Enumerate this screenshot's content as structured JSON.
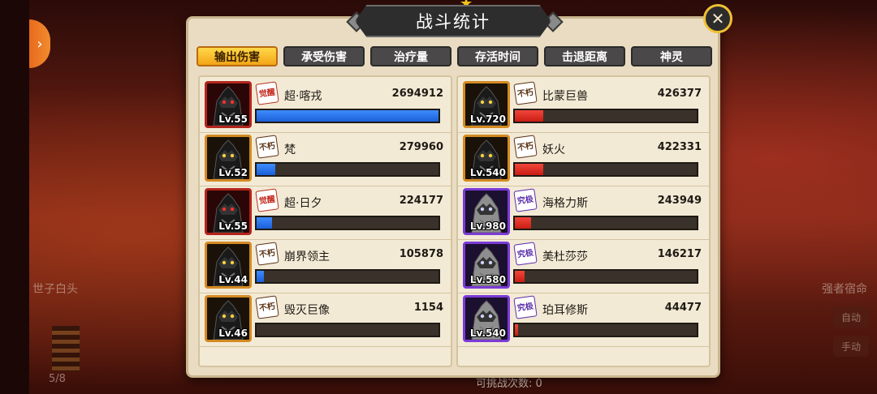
{
  "panel": {
    "title": "战斗统计",
    "tabs": [
      {
        "label": "输出伤害",
        "active": true
      },
      {
        "label": "承受伤害",
        "active": false
      },
      {
        "label": "治疗量",
        "active": false
      },
      {
        "label": "存活时间",
        "active": false
      },
      {
        "label": "击退距离",
        "active": false
      },
      {
        "label": "神灵",
        "active": false
      }
    ]
  },
  "left_team": [
    {
      "name": "超·喀戎",
      "value": "2694912",
      "level": "Lv.55",
      "rank": "觉醒",
      "frame": "red",
      "fill": 1.0
    },
    {
      "name": "梵",
      "value": "279960",
      "level": "Lv.52",
      "rank": "不朽",
      "frame": "orange",
      "fill": 0.104
    },
    {
      "name": "超·日夕",
      "value": "224177",
      "level": "Lv.55",
      "rank": "觉醒",
      "frame": "red",
      "fill": 0.083
    },
    {
      "name": "崩界领主",
      "value": "105878",
      "level": "Lv.44",
      "rank": "不朽",
      "frame": "orange",
      "fill": 0.039
    },
    {
      "name": "毁灭巨像",
      "value": "1154",
      "level": "Lv.46",
      "rank": "不朽",
      "frame": "orange",
      "fill": 0.0
    }
  ],
  "right_team": [
    {
      "name": "比蒙巨兽",
      "value": "426377",
      "level": "Lv.720",
      "rank": "不朽",
      "frame": "orange",
      "fill": 0.158
    },
    {
      "name": "妖火",
      "value": "422331",
      "level": "Lv.540",
      "rank": "不朽",
      "frame": "orange",
      "fill": 0.157
    },
    {
      "name": "海格力斯",
      "value": "243949",
      "level": "Lv.980",
      "rank": "究极",
      "frame": "purple",
      "fill": 0.09
    },
    {
      "name": "美杜莎莎",
      "value": "146217",
      "level": "Lv.580",
      "rank": "究极",
      "frame": "purple",
      "fill": 0.054
    },
    {
      "name": "珀耳修斯",
      "value": "44477",
      "level": "Lv.540",
      "rank": "究极",
      "frame": "purple",
      "fill": 0.017
    }
  ],
  "background": {
    "left_label": "世子白头",
    "right_label": "强者宿命",
    "energy": "5/8",
    "challenge_text": "可挑战次数: 0",
    "right_btn1": "自动",
    "right_btn2": "手动"
  },
  "icons": {
    "close": "close-icon",
    "side_tab": "chevron-right-icon",
    "star": "star-icon"
  },
  "colors": {
    "player_bar": "#1c5fd8",
    "enemy_bar": "#c81e14",
    "active_tab": "#f2a516"
  }
}
